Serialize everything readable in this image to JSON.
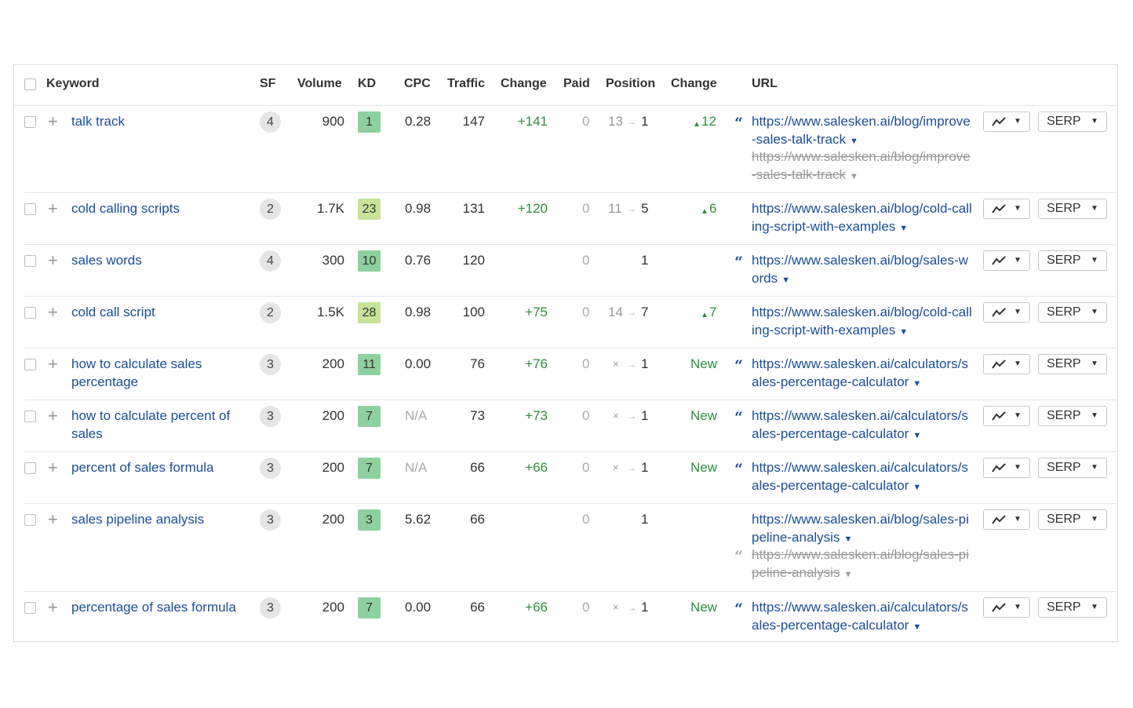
{
  "headers": {
    "keyword": "Keyword",
    "sf": "SF",
    "volume": "Volume",
    "kd": "KD",
    "cpc": "CPC",
    "traffic": "Traffic",
    "change": "Change",
    "paid": "Paid",
    "position": "Position",
    "pos_change": "Change",
    "url": "URL"
  },
  "colors": {
    "link": "#1a4e97",
    "positive": "#2e8f3c",
    "kd_low": "#8fd19e",
    "kd_mid": "#c6e39a"
  },
  "icons": {
    "chart": "trend-line-icon",
    "dropdown": "caret-down-icon",
    "quote": "featured-snippet-icon"
  },
  "serp_label": "SERP",
  "rows": [
    {
      "keyword": "talk track",
      "sf": "4",
      "volume": "900",
      "kd": "1",
      "cpc": "0.28",
      "traffic": "147",
      "change": "+141",
      "paid": "0",
      "pos_old": "13",
      "pos_new": "1",
      "pos_change": "12",
      "url": "https://www.salesken.ai/blog/improve-sales-talk-track",
      "url2": "https://www.salesken.ai/blog/improve-sales-talk-track"
    },
    {
      "keyword": "cold calling scripts",
      "sf": "2",
      "volume": "1.7K",
      "kd": "23",
      "cpc": "0.98",
      "traffic": "131",
      "change": "+120",
      "paid": "0",
      "pos_old": "11",
      "pos_new": "5",
      "pos_change": "6",
      "url": "https://www.salesken.ai/blog/cold-calling-script-with-examples"
    },
    {
      "keyword": "sales words",
      "sf": "4",
      "volume": "300",
      "kd": "10",
      "cpc": "0.76",
      "traffic": "120",
      "change": "",
      "paid": "0",
      "pos_old": "",
      "pos_new": "1",
      "pos_change": "",
      "url": "https://www.salesken.ai/blog/sales-words"
    },
    {
      "keyword": "cold call script",
      "sf": "2",
      "volume": "1.5K",
      "kd": "28",
      "cpc": "0.98",
      "traffic": "100",
      "change": "+75",
      "paid": "0",
      "pos_old": "14",
      "pos_new": "7",
      "pos_change": "7",
      "url": "https://www.salesken.ai/blog/cold-calling-script-with-examples"
    },
    {
      "keyword": "how to calculate sales percentage",
      "sf": "3",
      "volume": "200",
      "kd": "11",
      "cpc": "0.00",
      "traffic": "76",
      "change": "+76",
      "paid": "0",
      "pos_old": "×",
      "pos_new": "1",
      "pos_change": "New",
      "url": "https://www.salesken.ai/calculators/sales-percentage-calculator"
    },
    {
      "keyword": "how to calculate percent of sales",
      "sf": "3",
      "volume": "200",
      "kd": "7",
      "cpc": "N/A",
      "traffic": "73",
      "change": "+73",
      "paid": "0",
      "pos_old": "×",
      "pos_new": "1",
      "pos_change": "New",
      "url": "https://www.salesken.ai/calculators/sales-percentage-calculator"
    },
    {
      "keyword": "percent of sales formula",
      "sf": "3",
      "volume": "200",
      "kd": "7",
      "cpc": "N/A",
      "traffic": "66",
      "change": "+66",
      "paid": "0",
      "pos_old": "×",
      "pos_new": "1",
      "pos_change": "New",
      "url": "https://www.salesken.ai/calculators/sales-percentage-calculator"
    },
    {
      "keyword": "sales pipeline analysis",
      "sf": "3",
      "volume": "200",
      "kd": "3",
      "cpc": "5.62",
      "traffic": "66",
      "change": "",
      "paid": "0",
      "pos_old": "",
      "pos_new": "1",
      "pos_change": "",
      "url": "https://www.salesken.ai/blog/sales-pipeline-analysis",
      "url2": "https://www.salesken.ai/blog/sales-pipeline-analysis"
    },
    {
      "keyword": "percentage of sales formula",
      "sf": "3",
      "volume": "200",
      "kd": "7",
      "cpc": "0.00",
      "traffic": "66",
      "change": "+66",
      "paid": "0",
      "pos_old": "×",
      "pos_new": "1",
      "pos_change": "New",
      "url": "https://www.salesken.ai/calculators/sales-percentage-calculator"
    }
  ]
}
